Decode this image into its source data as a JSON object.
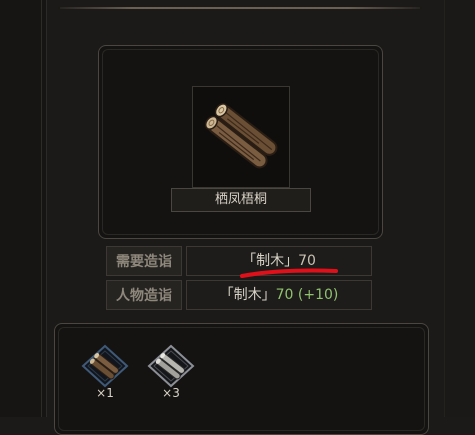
{
  "item": {
    "name": "栖凤梧桐",
    "icon": "wood-log-icon"
  },
  "requirements": {
    "need": {
      "label": "需要造诣",
      "value_text": "「制木」",
      "value_num": "70"
    },
    "person": {
      "label": "人物造诣",
      "value_text": "「制木」",
      "value_num": "70",
      "bonus": "(+10)"
    }
  },
  "materials": [
    {
      "icon": "wood-material-icon",
      "qty": "×1",
      "frame": "blue"
    },
    {
      "icon": "wood-material-icon",
      "qty": "×3",
      "frame": "grey"
    }
  ],
  "colors": {
    "bonus_green": "#8fc36e",
    "annotation_red": "#e0101a"
  }
}
